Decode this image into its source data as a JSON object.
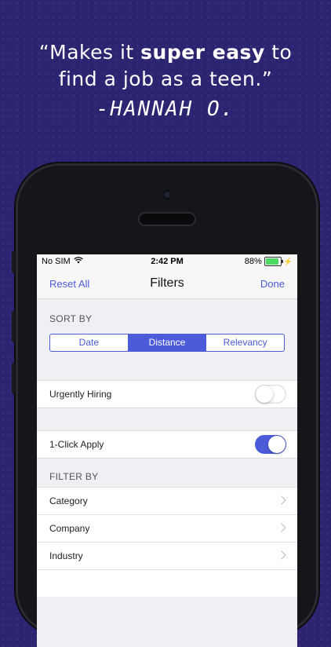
{
  "headline": {
    "quote_open": "“Makes it ",
    "quote_bold": "super easy",
    "quote_mid": " to",
    "quote_line2": "find a job as a teen.”",
    "author": "-HANNAH O."
  },
  "status_bar": {
    "carrier": "No SIM",
    "time": "2:42 PM",
    "battery": "88%",
    "battery_level": 0.88
  },
  "nav": {
    "left": "Reset All",
    "title": "Filters",
    "right": "Done"
  },
  "sort": {
    "label": "SORT BY",
    "options": [
      "Date",
      "Distance",
      "Relevancy"
    ],
    "selected": "Distance"
  },
  "toggles": {
    "urgently_hiring": {
      "label": "Urgently Hiring",
      "on": false
    },
    "one_click": {
      "label": "1-Click Apply",
      "on": true
    }
  },
  "filter": {
    "label": "FILTER BY",
    "items": [
      "Category",
      "Company",
      "Industry"
    ]
  },
  "colors": {
    "accent": "#4b5bd9",
    "background": "#2c2470"
  }
}
